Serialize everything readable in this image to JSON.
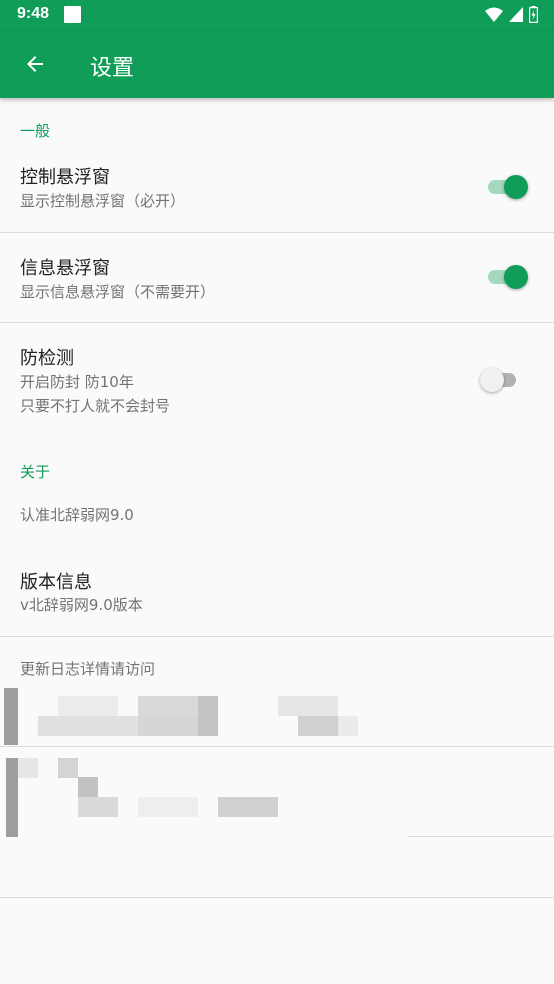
{
  "status_bar": {
    "time": "9:48",
    "colors": {
      "bar": "#0f9d58"
    }
  },
  "app_bar": {
    "title": "设置",
    "back_icon": "arrow-back-icon"
  },
  "sections": {
    "general": {
      "header": "一般",
      "items": [
        {
          "title": "控制悬浮窗",
          "summary": "显示控制悬浮窗（必开）",
          "switch_on": true
        },
        {
          "title": "信息悬浮窗",
          "summary": "显示信息悬浮窗（不需要开）",
          "switch_on": true
        },
        {
          "title": "防检测",
          "summary_line1": "开启防封 防10年",
          "summary_line2": "只要不打人就不会封号",
          "switch_on": false
        }
      ]
    },
    "about": {
      "header": "关于",
      "items": [
        {
          "summary": "认准北辞弱网9.0"
        },
        {
          "title": "版本信息",
          "summary": "v北辞弱网9.0版本"
        },
        {
          "summary": "更新日志详情请访问"
        }
      ]
    }
  },
  "colors": {
    "accent": "#0f9d58",
    "switch_track_on": "#a5d9bf",
    "switch_off_track": "#b2b2b2"
  }
}
